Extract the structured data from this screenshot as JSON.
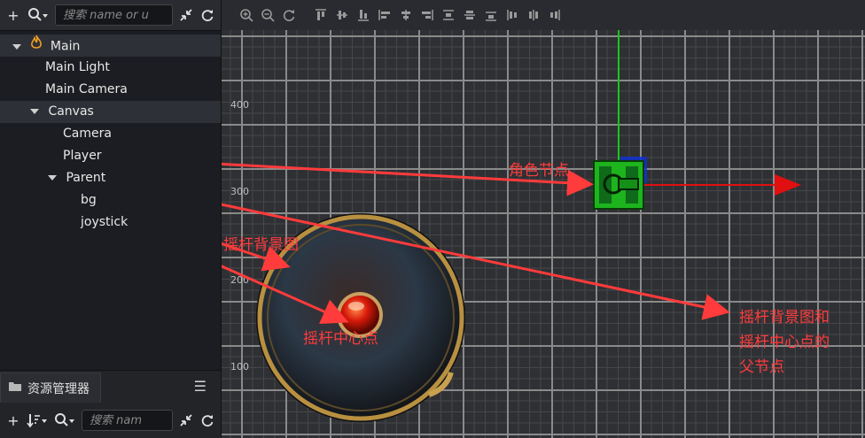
{
  "hierarchy": {
    "search_placeholder": "搜索 name or u",
    "nodes": [
      {
        "label": "Main",
        "depth": 0,
        "expanded": true
      },
      {
        "label": "Main Light",
        "depth": 1
      },
      {
        "label": "Main Camera",
        "depth": 1
      },
      {
        "label": "Canvas",
        "depth": 1,
        "expanded": true
      },
      {
        "label": "Camera",
        "depth": 2
      },
      {
        "label": "Player",
        "depth": 2
      },
      {
        "label": "Parent",
        "depth": 2,
        "expanded": true
      },
      {
        "label": "bg",
        "depth": 3
      },
      {
        "label": "joystick",
        "depth": 3
      }
    ]
  },
  "assets": {
    "tab_label": "资源管理器",
    "search_placeholder": "搜索 nam"
  },
  "scene": {
    "y_axis_labels": [
      "400",
      "300",
      "200",
      "100"
    ],
    "annotations": {
      "player": "角色节点",
      "bg": "摇杆背景图",
      "joystick": "摇杆中心点",
      "parent_line1": "摇杆背景图和",
      "parent_line2": "摇杆中心点的",
      "parent_line3": "父节点"
    }
  },
  "colors": {
    "annotation": "#ff3b3b",
    "gizmo_x": "#e01010",
    "gizmo_y": "#18c818",
    "selection_bg": "#2e3037"
  }
}
